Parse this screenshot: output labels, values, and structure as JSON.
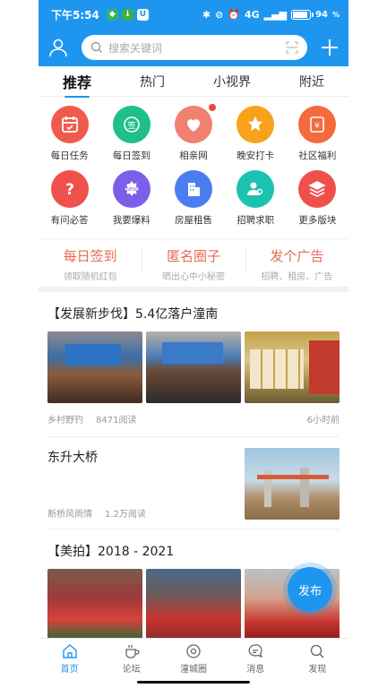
{
  "status": {
    "time": "下午5:54",
    "battery": "94",
    "battery_pct": 0.94,
    "net": "4G"
  },
  "header": {
    "search_placeholder": "搜索关键词"
  },
  "tabs": [
    "推荐",
    "热门",
    "小视界",
    "附近"
  ],
  "grid": [
    {
      "label": "每日任务",
      "icon": "calendar-icon",
      "color": "#f05a4d"
    },
    {
      "label": "每日签到",
      "icon": "sign-in-icon",
      "color": "#1fbf8a"
    },
    {
      "label": "相亲网",
      "icon": "heart-icon",
      "color": "#f08070"
    },
    {
      "label": "晚安打卡",
      "icon": "moon-star-icon",
      "color": "#f8a21c"
    },
    {
      "label": "社区福利",
      "icon": "gift-icon",
      "color": "#f56a3a"
    },
    {
      "label": "有问必答",
      "icon": "question-icon",
      "color": "#f0504a"
    },
    {
      "label": "我要爆料",
      "icon": "news-icon",
      "color": "#7d5ee8"
    },
    {
      "label": "房屋租售",
      "icon": "building-icon",
      "color": "#4b7cf0"
    },
    {
      "label": "招聘求职",
      "icon": "job-search-icon",
      "color": "#1cc2b0"
    },
    {
      "label": "更多版块",
      "icon": "layers-icon",
      "color": "#f0504a"
    }
  ],
  "promos": [
    {
      "title": "每日签到",
      "sub": "领取随机红包"
    },
    {
      "title": "匿名圈子",
      "sub": "晒出心中小秘密"
    },
    {
      "title": "发个广告",
      "sub": "招聘、租房、广告"
    }
  ],
  "articles": [
    {
      "title": "【发展新步伐】5.4亿落户潼南",
      "source": "乡村野钓",
      "reads": "8471阅读",
      "time": "6小时前"
    },
    {
      "title": "东升大桥",
      "source": "断桥风雨情",
      "reads": "1.2万阅读"
    },
    {
      "title": "【美拍】2018 - 2021"
    }
  ],
  "fab_label": "发布",
  "bottom_nav": [
    "首页",
    "论坛",
    "潼城圈",
    "消息",
    "发现"
  ],
  "colors": {
    "accent": "#1e96f0",
    "promo": "#e56a54"
  }
}
